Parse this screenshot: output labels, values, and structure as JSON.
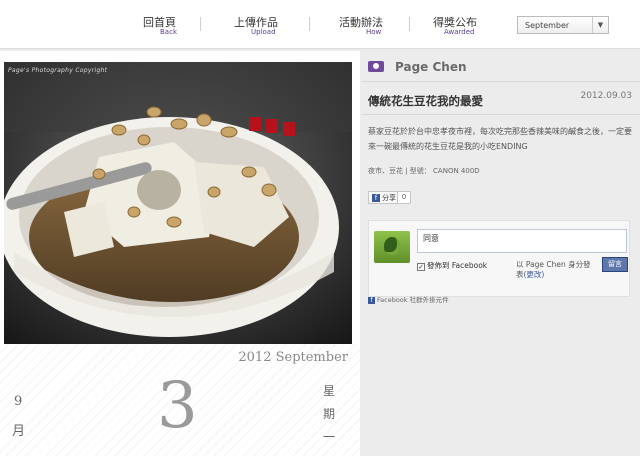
{
  "nav": [
    {
      "zh": "回首頁",
      "en": "Back"
    },
    {
      "zh": "上傳作品",
      "en": "Upload"
    },
    {
      "zh": "活動辦法",
      "en": "How"
    },
    {
      "zh": "得獎公布",
      "en": "Awarded"
    }
  ],
  "month_select": {
    "value": "September"
  },
  "photo": {
    "watermark": "Page's Photography Copyright"
  },
  "date": {
    "year_month": "2012 September",
    "month_num": "9",
    "month_unit": "月",
    "day": "3",
    "weekday": [
      "星",
      "期",
      "一"
    ]
  },
  "post": {
    "author": "Page Chen",
    "title": "傳統花生豆花我的最愛",
    "date": "2012.09.03",
    "body": "蔡家豆花於於台中忠孝夜市裡，每次吃完那些香辣美味的鹹食之後，一定要來一碗最傳統的花生豆花是我的小吃ENDING",
    "tags": "夜市、豆花 | 型號： CANON 400D"
  },
  "share": {
    "label": "分享",
    "count": "0"
  },
  "comment": {
    "input_value": "同意",
    "checkbox_label": "發佈到 Facebook",
    "as_user": "以 Page Chen 身分發表",
    "change_link": "(更改)",
    "post_label": "留言",
    "plugin_label": "Facebook 社群外掛元件"
  },
  "colors": {
    "accent": "#6f4a9c",
    "facebook": "#3b5998"
  }
}
